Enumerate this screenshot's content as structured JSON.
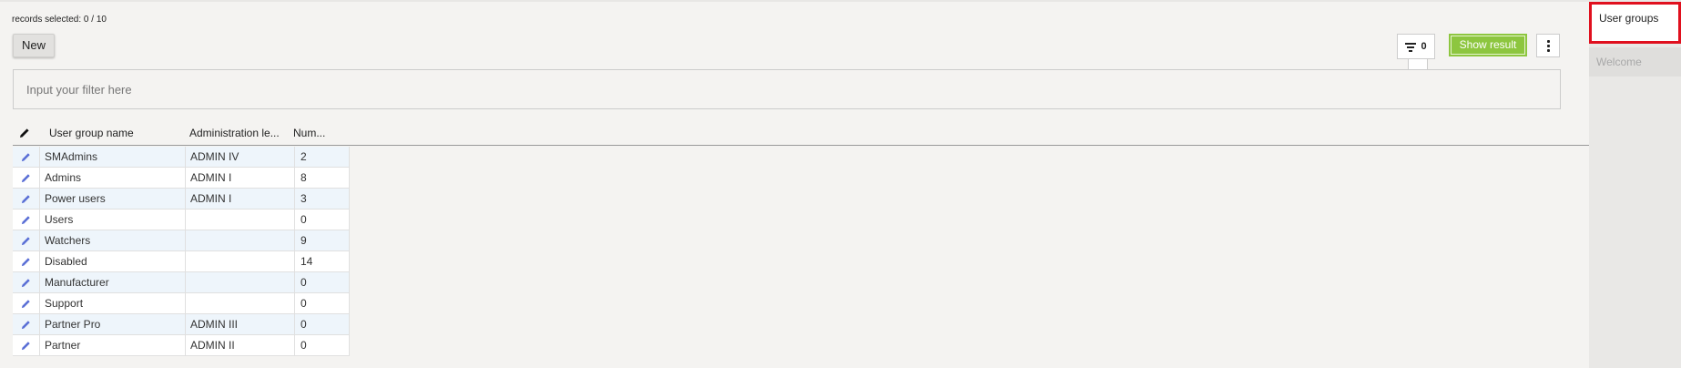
{
  "header": {
    "records_selected": "records selected: 0 / 10"
  },
  "toolbar": {
    "new_label": "New",
    "filter_count": "0",
    "show_result_label": "Show result",
    "menu_icon": "kebab-vertical-icon"
  },
  "filter": {
    "placeholder": "Input your filter here",
    "value": ""
  },
  "grid": {
    "columns": [
      "User group name",
      "Administration le...",
      "Num..."
    ],
    "rows": [
      {
        "name": "SMAdmins",
        "level": "ADMIN IV",
        "num": "2"
      },
      {
        "name": "Admins",
        "level": "ADMIN I",
        "num": "8"
      },
      {
        "name": "Power users",
        "level": "ADMIN I",
        "num": "3"
      },
      {
        "name": "Users",
        "level": "",
        "num": "0"
      },
      {
        "name": "Watchers",
        "level": "",
        "num": "9"
      },
      {
        "name": "Disabled",
        "level": "",
        "num": "14"
      },
      {
        "name": "Manufacturer",
        "level": "",
        "num": "0"
      },
      {
        "name": "Support",
        "level": "",
        "num": "0"
      },
      {
        "name": "Partner Pro",
        "level": "ADMIN III",
        "num": "0"
      },
      {
        "name": "Partner",
        "level": "ADMIN II",
        "num": "0"
      }
    ]
  },
  "sidebar": {
    "items": [
      {
        "label": "User groups",
        "active": true
      },
      {
        "label": "Welcome",
        "active": false
      }
    ]
  },
  "colors": {
    "accent_green": "#8dc63f",
    "highlight_red": "#e0101e",
    "row_alt": "#eef5fb",
    "edit_icon": "#5a6fd6"
  }
}
